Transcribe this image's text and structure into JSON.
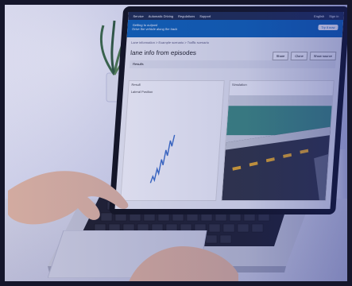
{
  "screen_app": {
    "topbar_items": [
      "Service",
      "Automatic Driving",
      "Regulations",
      "Support",
      "English",
      "Sign in"
    ],
    "banner_title": "Getting to outpost",
    "banner_subtitle": "Drive the vehicle along the track",
    "try_button": "Try it now",
    "breadcrumb": "Lane information > Example scenario > Traffic scenario",
    "page_title": "lane info from episodes",
    "buttons": [
      "Share",
      "Clone",
      "Show source"
    ],
    "section_label": "Results",
    "left_plot_label": "Result",
    "left_plot_y_label": "Lateral Position",
    "right_plot_label": "Simulation"
  },
  "colors": {
    "banner_blue": "#0b63b6",
    "road_dark": "#2f3238",
    "lane_yellow": "#f2b01e",
    "grass_teal": "#3d8f7a"
  },
  "icons": [
    "plant-pot-icon",
    "coffee-mug-icon",
    "laptop-icon"
  ]
}
